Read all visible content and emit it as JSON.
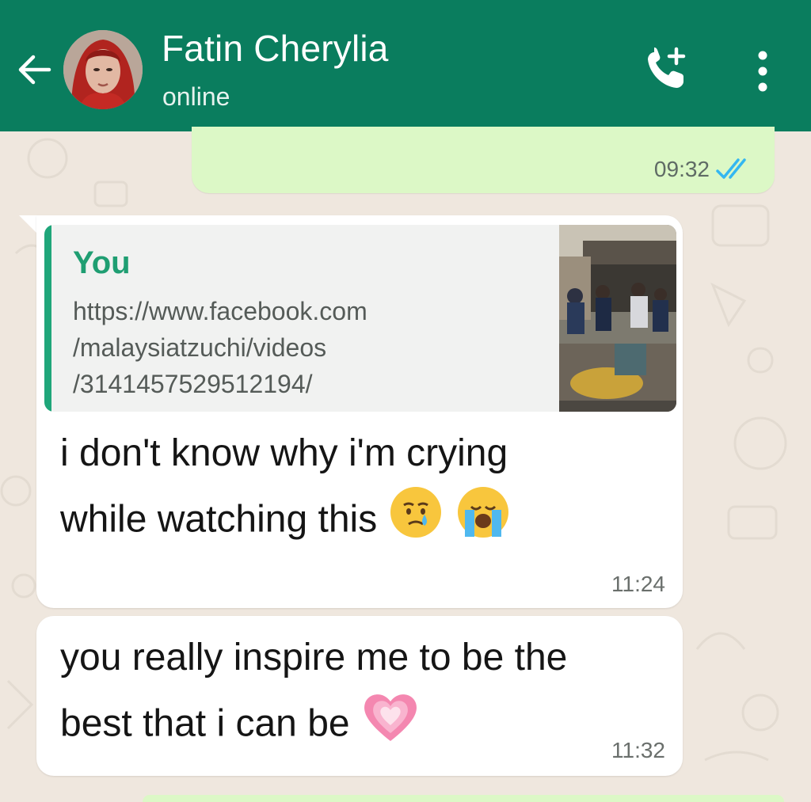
{
  "header": {
    "contact_name": "Fatin Cherylia",
    "status": "online",
    "icons": [
      "back-arrow-icon",
      "add-call-icon",
      "more-vertical-icon"
    ]
  },
  "messages": {
    "outgoing_top": {
      "time": "09:32",
      "status_icon": "double-check-read-icon"
    },
    "incoming_1": {
      "quote_author": "You",
      "quote_link": "https://www.facebook.com\n/malaysiatzuchi/videos\n/3141457529512194/",
      "text": "i don't know why i'm crying\nwhile watching this",
      "emojis": [
        "crying-face-emoji",
        "loudly-crying-face-emoji"
      ],
      "time": "11:24"
    },
    "incoming_2": {
      "text": "you really inspire me to be the\nbest that i can be",
      "emojis": [
        "pink-heart-emoji"
      ],
      "time": "11:32"
    }
  },
  "colors": {
    "header": "#0a7d5e",
    "outgoing_bubble": "#dcf8c6",
    "incoming_bubble": "#ffffff",
    "quote_accent": "#1fa67a",
    "read_ticks": "#34b7f1"
  }
}
